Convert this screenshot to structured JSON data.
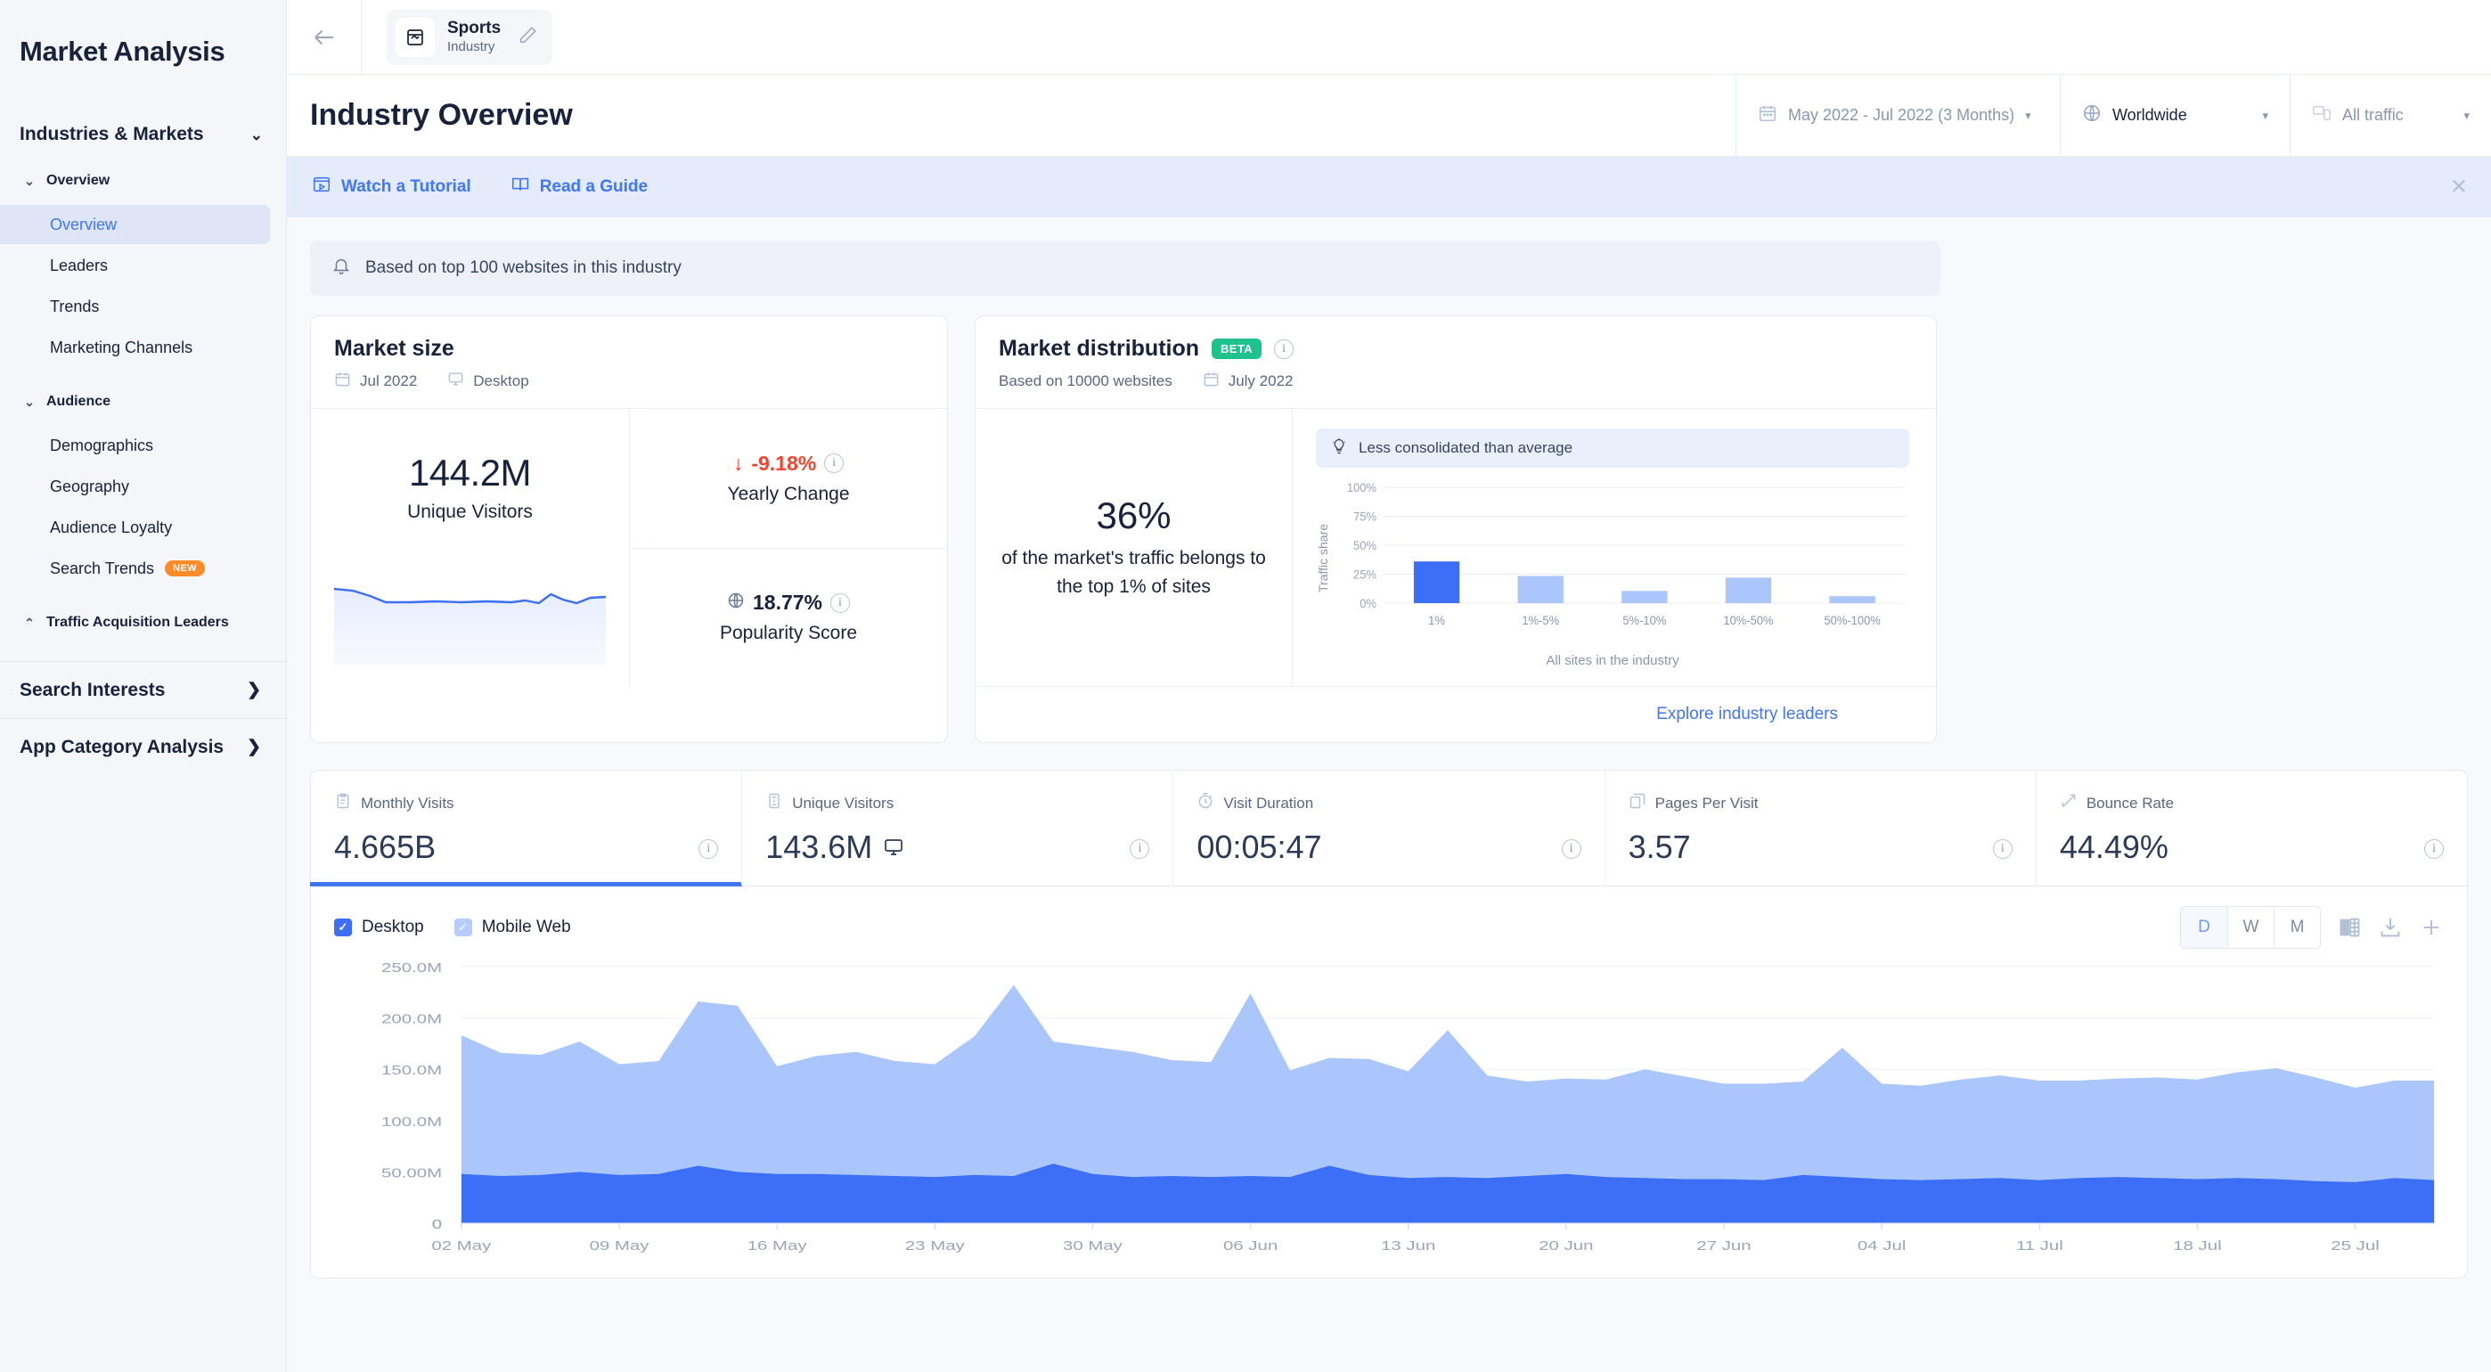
{
  "sidebar": {
    "brand": "Market Analysis",
    "section": {
      "label": "Industries & Markets",
      "chevron": "chevron-down"
    },
    "groups": [
      {
        "label": "Overview",
        "items": [
          {
            "label": "Overview",
            "active": true
          },
          {
            "label": "Leaders",
            "active": false
          },
          {
            "label": "Trends",
            "active": false
          },
          {
            "label": "Marketing Channels",
            "active": false
          }
        ]
      },
      {
        "label": "Audience",
        "items": [
          {
            "label": "Demographics",
            "badge": ""
          },
          {
            "label": "Geography",
            "badge": ""
          },
          {
            "label": "Audience Loyalty",
            "badge": ""
          },
          {
            "label": "Search Trends",
            "badge": "NEW"
          }
        ]
      },
      {
        "label": "Traffic Acquisition Leaders",
        "items": []
      }
    ],
    "big_rows": [
      {
        "label": "Search Interests",
        "arrow": "›"
      },
      {
        "label": "App Category Analysis",
        "arrow": "›"
      }
    ]
  },
  "topbar": {
    "back": "←",
    "tab": {
      "title": "Sports",
      "subtitle": "Industry",
      "edit": "✎"
    }
  },
  "header": {
    "title": "Industry Overview",
    "filters": [
      {
        "name": "date-range",
        "value": "May 2022 - Jul 2022 (3 Months)",
        "icon": "calendar-icon",
        "caret": "▾"
      },
      {
        "name": "region",
        "value": "Worldwide",
        "icon": "globe-icon",
        "caret": "▾"
      },
      {
        "name": "traffic-type",
        "value": "All traffic",
        "icon": "devices-icon",
        "caret": "▾"
      }
    ]
  },
  "promo": {
    "links": [
      {
        "label": "Watch a Tutorial",
        "icon": "video-icon"
      },
      {
        "label": "Read a Guide",
        "icon": "book-icon"
      }
    ],
    "close": "✕"
  },
  "note": {
    "text": "Based on top 100 websites in this industry",
    "icon": "bell-icon"
  },
  "market_size": {
    "title": "Market size",
    "date": "Jul 2022",
    "device": "Desktop",
    "big_value": "144.2M",
    "big_label": "Unique Visitors",
    "yearly_change": {
      "value": "-9.18%",
      "arrow": "↓",
      "label": "Yearly Change",
      "color": "#f5442e"
    },
    "popularity": {
      "value": "18.77%",
      "label": "Popularity Score"
    }
  },
  "market_distribution": {
    "title": "Market distribution",
    "beta": "BETA",
    "sub_websites": "Based on 10000 websites",
    "sub_date": "July 2022",
    "pct": "36%",
    "desc": "of the market's traffic belongs to the top 1% of sites",
    "hint": "Less consolidated than average",
    "explore_link": "Explore industry leaders"
  },
  "kpis": [
    {
      "label": "Monthly Visits",
      "value": "4.665B",
      "icon": "clipboard-icon",
      "active": true,
      "device_icon": ""
    },
    {
      "label": "Unique Visitors",
      "value": "143.6M",
      "icon": "person-icon",
      "active": false,
      "device_icon": "desktop-icon"
    },
    {
      "label": "Visit Duration",
      "value": "00:05:47",
      "icon": "stopwatch-icon",
      "active": false,
      "device_icon": ""
    },
    {
      "label": "Pages Per Visit",
      "value": "3.57",
      "icon": "pages-icon",
      "active": false,
      "device_icon": ""
    },
    {
      "label": "Bounce Rate",
      "value": "44.49%",
      "icon": "trend-icon",
      "active": false,
      "device_icon": ""
    }
  ],
  "chart_toolbar": {
    "legend": [
      {
        "label": "Desktop",
        "checked": true,
        "color": "#3c6ff5"
      },
      {
        "label": "Mobile Web",
        "checked": true,
        "color": "#b6cdfb"
      }
    ],
    "granularity": [
      {
        "label": "D",
        "on": true
      },
      {
        "label": "W",
        "on": false
      },
      {
        "label": "M",
        "on": false
      }
    ],
    "actions": [
      {
        "name": "excel-export-icon"
      },
      {
        "name": "download-icon"
      },
      {
        "name": "add-icon",
        "label": "+"
      }
    ]
  },
  "chart_data": [
    {
      "type": "bar",
      "name": "market-distribution-bar",
      "title": "",
      "xlabel": "All sites in the industry",
      "ylabel": "Traffic share",
      "categories": [
        "1%",
        "1%-5%",
        "5%-10%",
        "10%-50%",
        "50%-100%"
      ],
      "values": [
        36,
        23.5,
        10.5,
        22,
        6
      ],
      "ylim": [
        0,
        100
      ],
      "yticks": [
        "0%",
        "25%",
        "50%",
        "75%",
        "100%"
      ],
      "colors": [
        "#3c6ff5",
        "#aac6fb",
        "#aac6fb",
        "#aac6fb",
        "#aac6fb"
      ],
      "grid": true,
      "legend": "none"
    },
    {
      "type": "area",
      "name": "traffic-over-time-area",
      "title": "",
      "xlabel": "",
      "ylabel": "",
      "stacked": true,
      "ylim": [
        0,
        250000000
      ],
      "yticks": [
        "0",
        "50.00M",
        "100.0M",
        "150.0M",
        "200.0M",
        "250.0M"
      ],
      "xticks": [
        "02 May",
        "09 May",
        "16 May",
        "23 May",
        "30 May",
        "06 Jun",
        "13 Jun",
        "20 Jun",
        "27 Jun",
        "04 Jul",
        "11 Jul",
        "18 Jul",
        "25 Jul"
      ],
      "grid": true,
      "legend": "top-left",
      "series": [
        {
          "name": "Desktop",
          "color": "#3c6ff5",
          "values": [
            48,
            46,
            47,
            50,
            47,
            48,
            56,
            50,
            48,
            48,
            47,
            46,
            45,
            47,
            46,
            58,
            48,
            45,
            46,
            45,
            46,
            45,
            56,
            47,
            44,
            45,
            44,
            46,
            48,
            45,
            44,
            43,
            43,
            42,
            47,
            45,
            43,
            42,
            43,
            44,
            42,
            44,
            45,
            44,
            43,
            44,
            43,
            41,
            40,
            44,
            42
          ]
        },
        {
          "name": "Mobile Web",
          "color": "#aac6fb",
          "values": [
            135,
            120,
            117,
            127,
            108,
            110,
            160,
            162,
            105,
            115,
            120,
            112,
            110,
            135,
            186,
            119,
            124,
            122,
            113,
            112,
            178,
            104,
            105,
            113,
            104,
            143,
            100,
            92,
            93,
            95,
            106,
            100,
            93,
            94,
            91,
            126,
            93,
            92,
            97,
            100,
            97,
            95,
            96,
            98,
            97,
            103,
            108,
            101,
            92,
            95,
            97
          ]
        }
      ]
    }
  ]
}
